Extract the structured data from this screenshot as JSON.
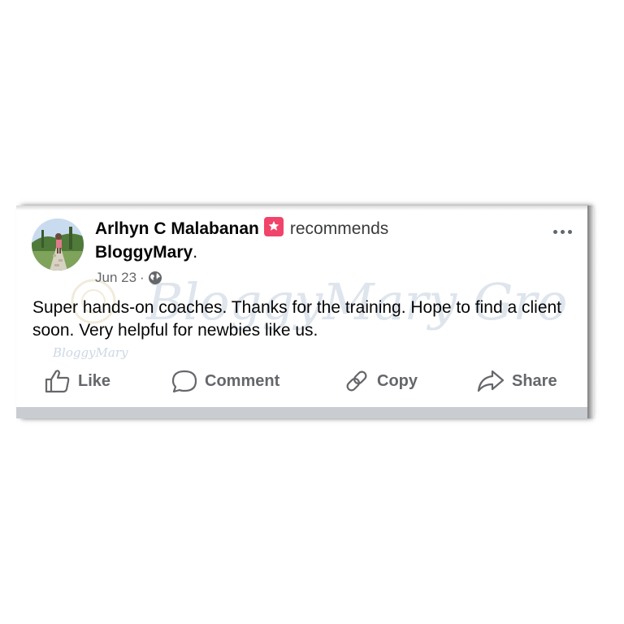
{
  "post": {
    "author_name": "Arlhyn C Malabanan",
    "verb": "recommends",
    "page_name": "BloggyMary",
    "page_suffix": ".",
    "date": "Jun 23",
    "separator": "·",
    "body": "Super hands-on coaches. Thanks for the training. Hope to find a client soon. Very helpful for newbies like us."
  },
  "watermark": {
    "text": "BloggyMary Group",
    "small_text": "BloggyMary"
  },
  "actions": [
    {
      "label": "Like",
      "icon": "thumbs-up-icon"
    },
    {
      "label": "Comment",
      "icon": "comment-bubble-icon"
    },
    {
      "label": "Copy",
      "icon": "link-icon"
    },
    {
      "label": "Share",
      "icon": "share-arrow-icon"
    }
  ],
  "colors": {
    "recommend_badge": "#f0446a",
    "text_primary": "#050505",
    "text_secondary": "#65676b",
    "divider": "#c9ccd1"
  }
}
